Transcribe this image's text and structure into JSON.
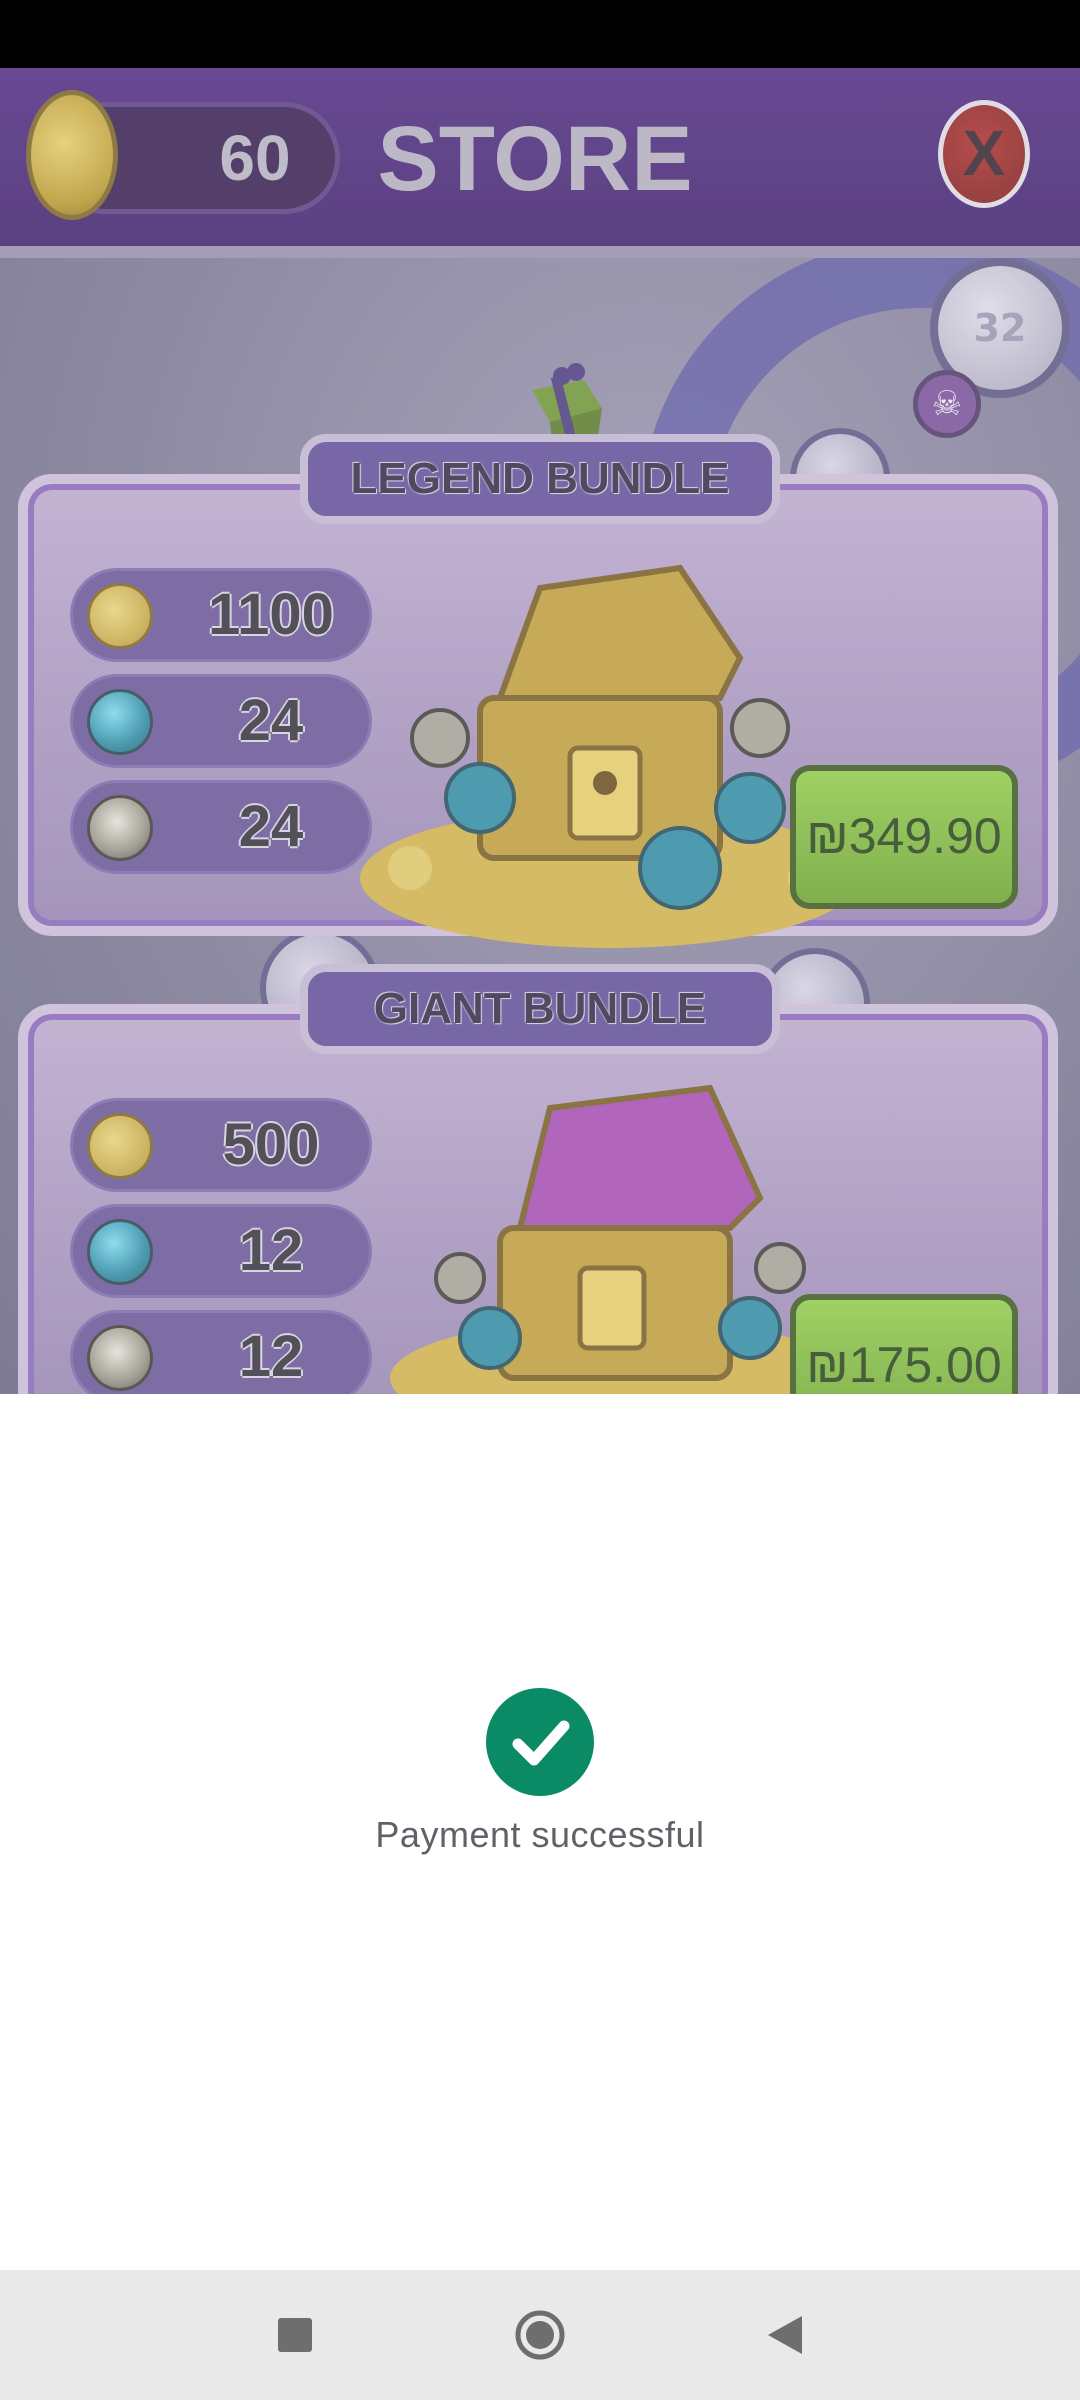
{
  "store": {
    "coin_balance": "60",
    "title": "STORE",
    "close_label": "X",
    "level_number": "32",
    "bundles": [
      {
        "name": "LEGEND BUNDLE",
        "coins": "1100",
        "gems": "24",
        "bombs": "24",
        "price": "₪349.90"
      },
      {
        "name": "GIANT BUNDLE",
        "coins": "500",
        "gems": "12",
        "bombs": "12",
        "price": "₪175.00"
      }
    ]
  },
  "payment": {
    "status_text": "Payment successful",
    "status_color": "#0b8a66"
  },
  "nav": {
    "icons": [
      "recents-square-icon",
      "home-circle-icon",
      "back-triangle-icon"
    ]
  }
}
